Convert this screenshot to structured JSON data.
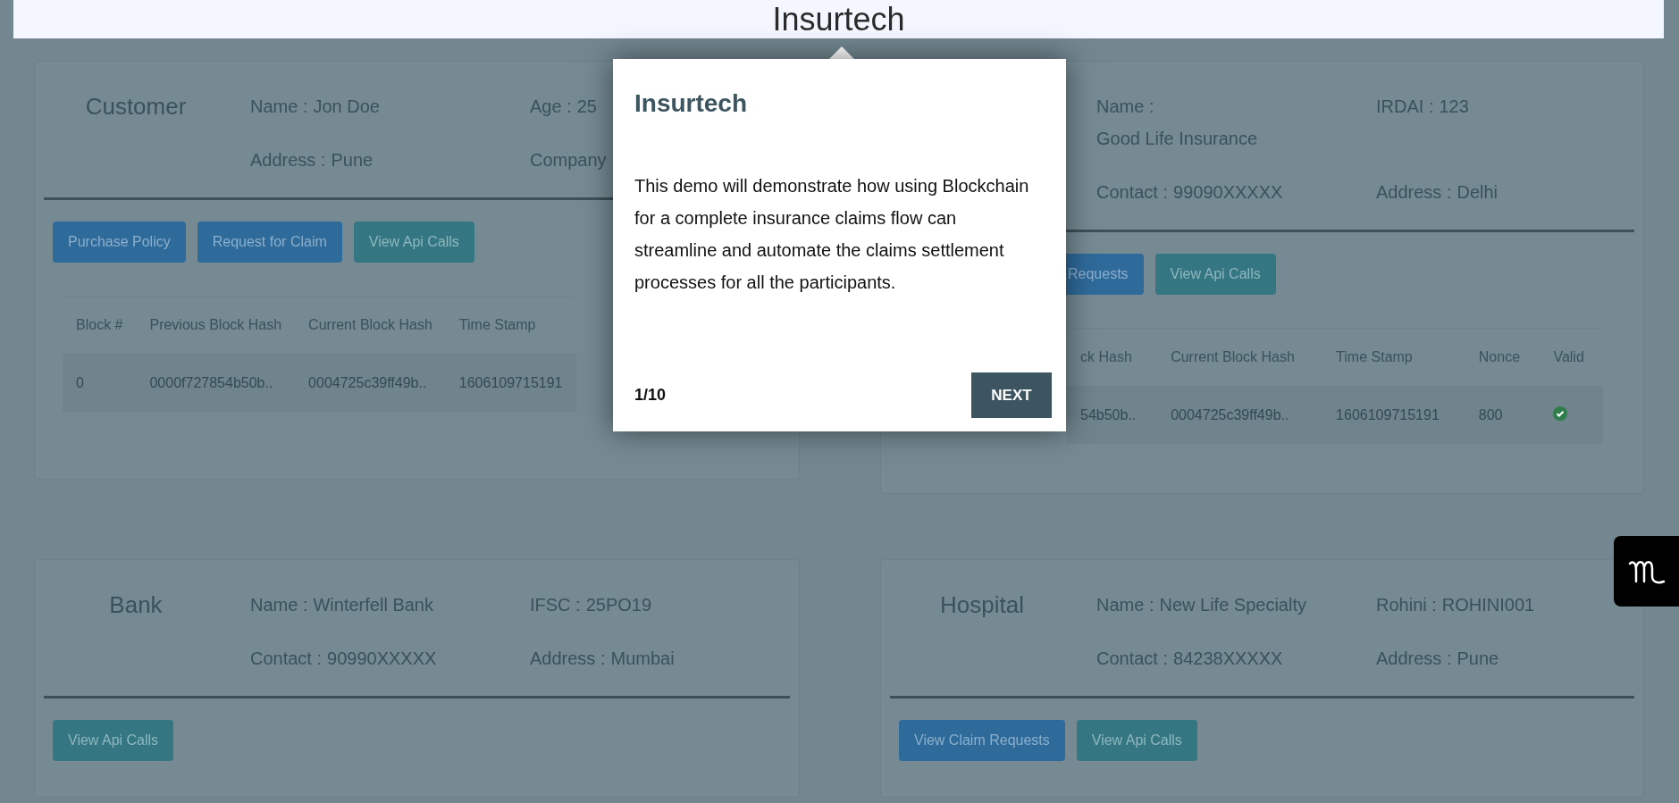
{
  "header": {
    "title": "Insurtech"
  },
  "cards": [
    {
      "title": "Customer",
      "fields": [
        {
          "label": "Name :",
          "value": "Jon Doe"
        },
        {
          "label": "Age :",
          "value": "25"
        },
        {
          "label": "Address :",
          "value": "Pune"
        },
        {
          "label": "Company"
        }
      ],
      "buttons": [
        {
          "label": "Purchase Policy",
          "kind": "primary"
        },
        {
          "label": "Request for Claim",
          "kind": "primary"
        },
        {
          "label": "View Api Calls",
          "kind": "info"
        }
      ],
      "table": {
        "columns": [
          "Block #",
          "Previous Block Hash",
          "Current Block Hash",
          "Time Stamp"
        ],
        "rows": [
          {
            "cells": [
              "0",
              "0000f727854b50b..",
              "0004725c39ff49b..",
              "1606109715191"
            ]
          }
        ]
      }
    },
    {
      "fields": [
        {
          "label": "Name :",
          "value": "Good Life Insurance",
          "value_wrapped": true
        },
        {
          "label": "IRDAI :",
          "value": "123"
        },
        {
          "label": "Contact :",
          "value": "99090XXXXX"
        },
        {
          "label": "Address :",
          "value": "Delhi"
        }
      ],
      "buttons": [
        {
          "label": "Requests",
          "kind": "primary"
        },
        {
          "label": "View Api Calls",
          "kind": "info"
        }
      ],
      "table": {
        "columns": [
          "ck Hash",
          "Current Block Hash",
          "Time Stamp",
          "Nonce",
          "Valid"
        ],
        "rows": [
          {
            "cells": [
              "54b50b..",
              "0004725c39ff49b..",
              "1606109715191",
              "800"
            ],
            "valid": true
          }
        ]
      }
    },
    {
      "title": "Bank",
      "fields": [
        {
          "label": "Name :",
          "value": "Winterfell Bank"
        },
        {
          "label": "IFSC :",
          "value": "25PO19"
        },
        {
          "label": "Contact :",
          "value": "90990XXXXX"
        },
        {
          "label": "Address :",
          "value": "Mumbai"
        }
      ],
      "buttons": [
        {
          "label": "View Api Calls",
          "kind": "info"
        }
      ]
    },
    {
      "title": "Hospital",
      "fields": [
        {
          "label": "Name :",
          "value": "New Life Specialty"
        },
        {
          "label": "Rohini :",
          "value": "ROHINI001"
        },
        {
          "label": "Contact :",
          "value": "84238XXXXX"
        },
        {
          "label": "Address :",
          "value": "Pune"
        }
      ],
      "buttons": [
        {
          "label": "View Claim Requests",
          "kind": "primary"
        },
        {
          "label": "View Api Calls",
          "kind": "info"
        }
      ]
    }
  ],
  "tour_popup": {
    "title": "Insurtech",
    "body": "This demo will demonstrate how using Blockchain for a complete insurance claims flow can streamline and automate the claims settlement processes for all the participants.",
    "step": "1/10",
    "next_label": "NEXT"
  }
}
